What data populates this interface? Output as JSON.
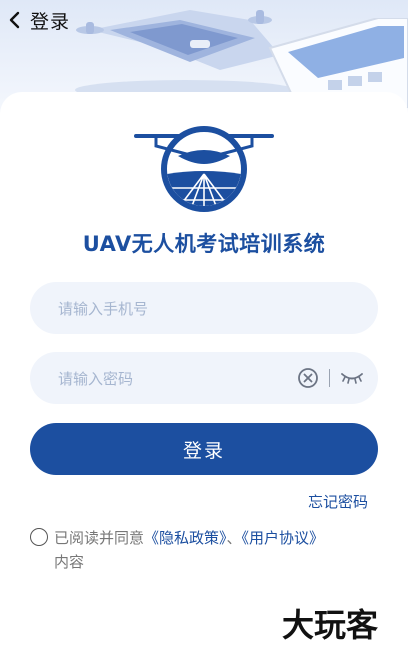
{
  "nav": {
    "back_label": "登录"
  },
  "app": {
    "title": "UAV无人机考试培训系统"
  },
  "form": {
    "phone_placeholder": "请输入手机号",
    "password_placeholder": "请输入密码",
    "submit_label": "登录",
    "forgot_label": "忘记密码"
  },
  "agreement": {
    "prefix": "已阅读并同意",
    "privacy_link": "《隐私政策》",
    "separator": "、",
    "user_link": "《用户协议》",
    "suffix": "内容"
  },
  "watermark": {
    "text": "大玩客"
  },
  "colors": {
    "primary": "#1c4fa0",
    "input_bg": "#f0f4fb",
    "placeholder": "#a6b6d0",
    "hero_bg": "#e6edf8"
  },
  "icons": [
    "chevron-left-icon",
    "clear-icon",
    "eye-closed-icon",
    "radio-unchecked-icon",
    "uav-logo-icon"
  ]
}
